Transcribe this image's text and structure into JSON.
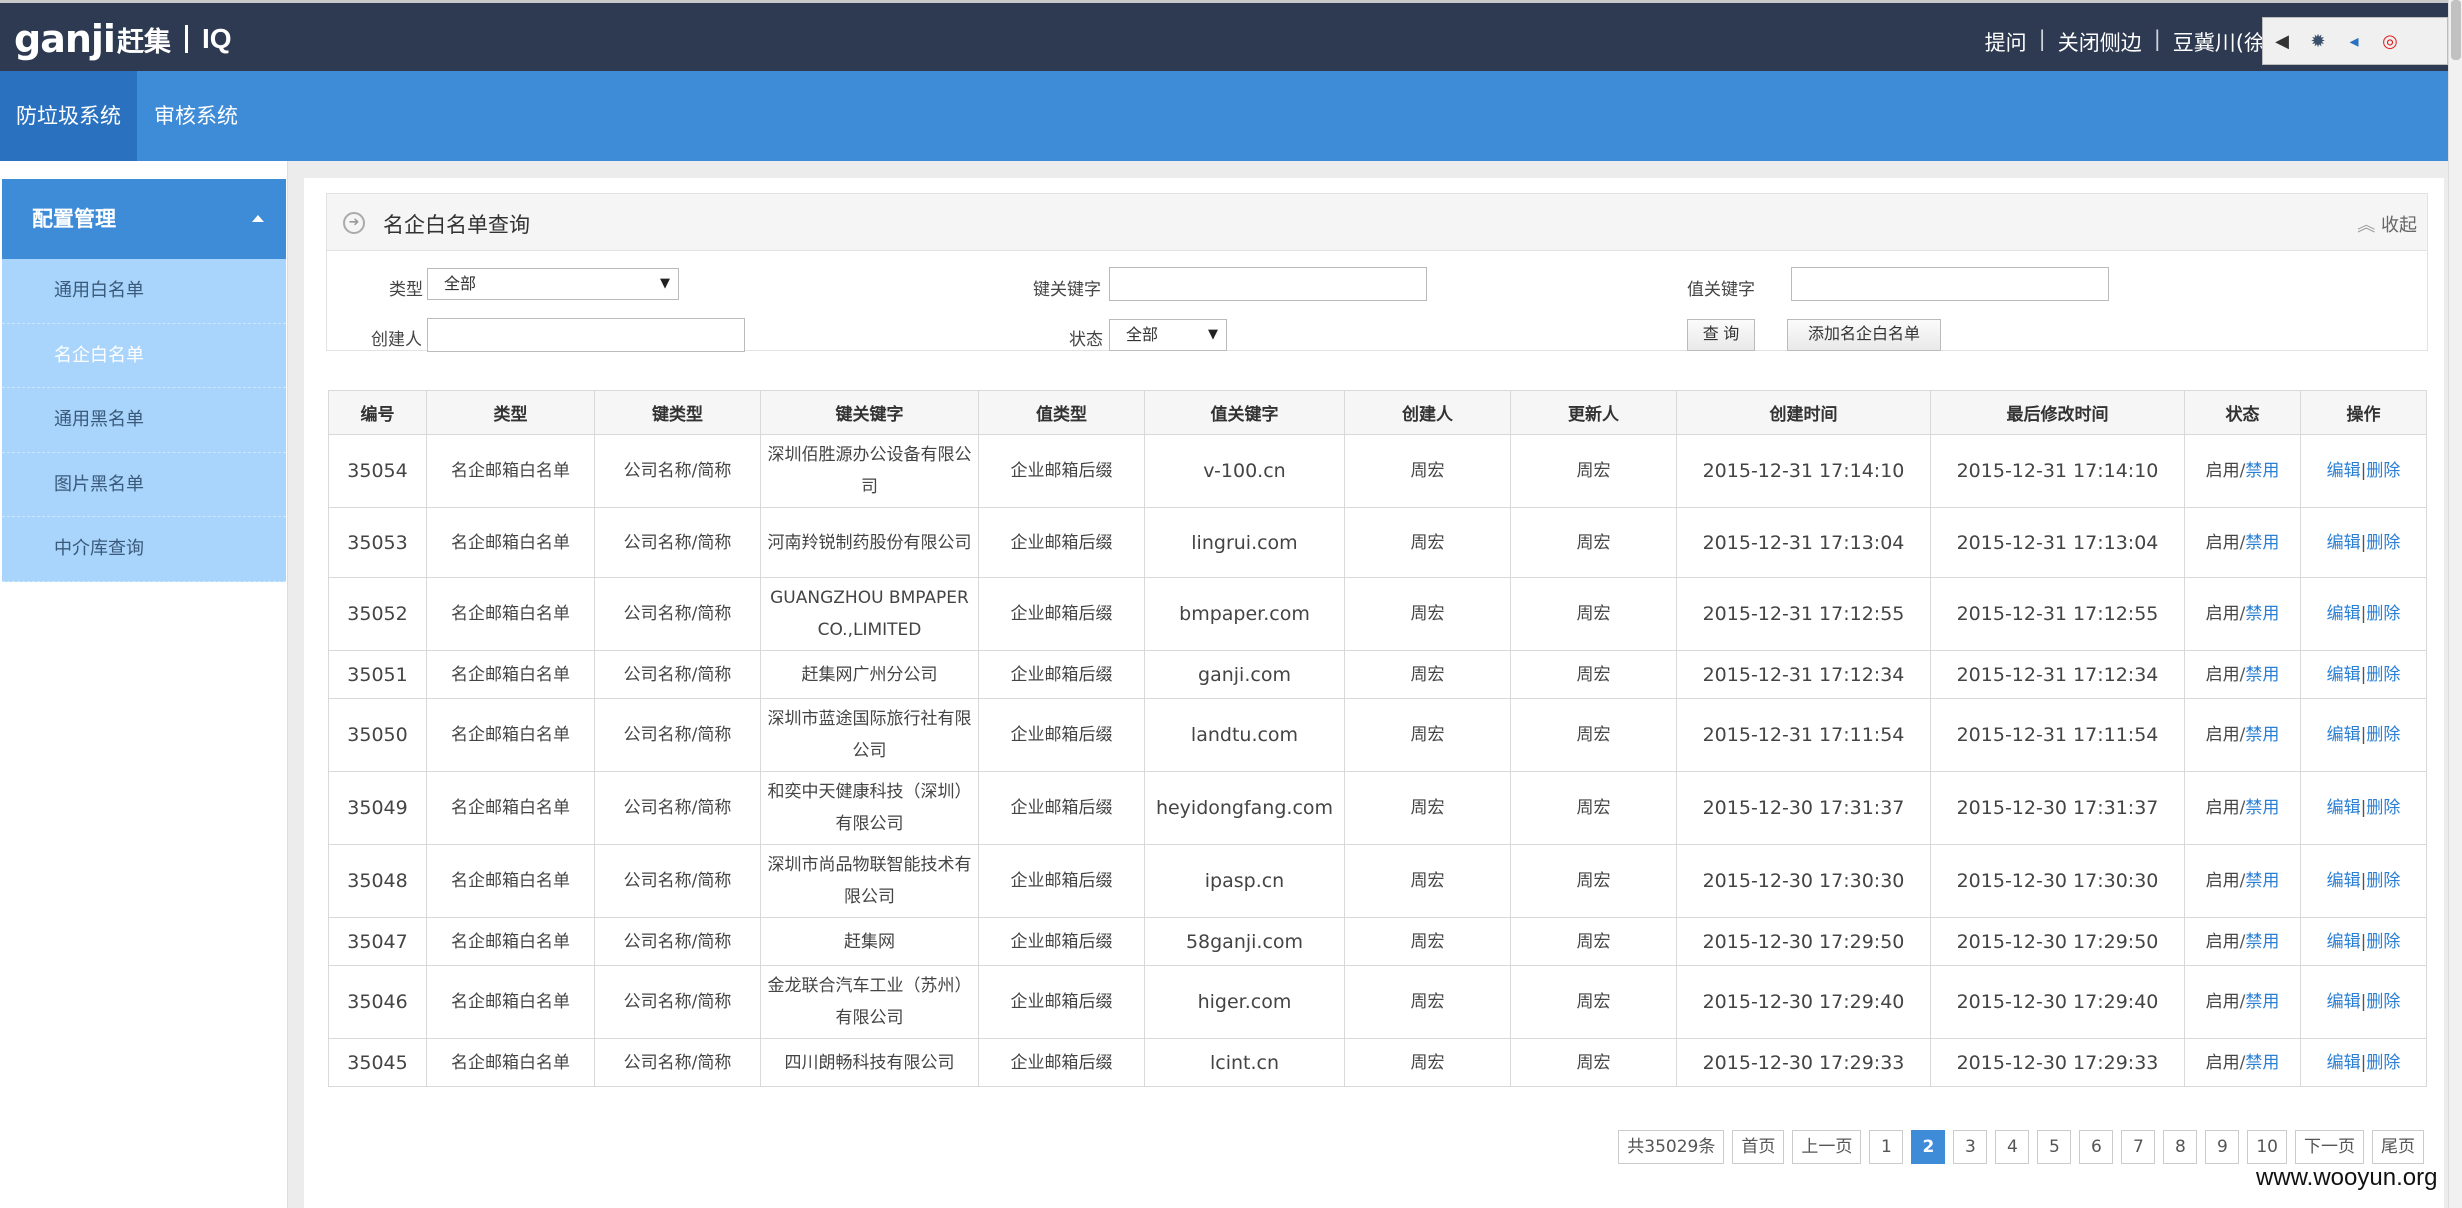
{
  "header": {
    "logo_main": "ganji",
    "logo_cn": "赶集",
    "logo_iq": "IQ",
    "links": [
      "提问",
      "关闭侧边",
      "豆冀川(徐洋"
    ],
    "tray_icons": [
      "arrow-left-icon",
      "gear-icon",
      "triangle-left-icon",
      "lifebuoy-icon"
    ]
  },
  "nav": {
    "items": [
      {
        "label": "防垃圾系统",
        "active": true
      },
      {
        "label": "审核系统",
        "active": false
      }
    ]
  },
  "sidebar": {
    "section": "配置管理",
    "items": [
      {
        "label": "通用白名单",
        "active": false
      },
      {
        "label": "名企白名单",
        "active": true
      },
      {
        "label": "通用黑名单",
        "active": false
      },
      {
        "label": "图片黑名单",
        "active": false
      },
      {
        "label": "中介库查询",
        "active": false
      }
    ]
  },
  "panel": {
    "title": "名企白名单查询",
    "collapse_label": "收起"
  },
  "form": {
    "type_label": "类型",
    "type_value": "全部",
    "key_label": "键关键字",
    "key_value": "",
    "val_label": "值关键字",
    "val_value": "",
    "creator_label": "创建人",
    "creator_value": "",
    "status_label": "状态",
    "status_value": "全部",
    "query_button": "查 询",
    "add_button": "添加名企白名单"
  },
  "table": {
    "columns": [
      "编号",
      "类型",
      "键类型",
      "键关键字",
      "值类型",
      "值关键字",
      "创建人",
      "更新人",
      "创建时间",
      "最后修改时间",
      "状态",
      "操作"
    ],
    "action_enable": "启用",
    "action_disable": "禁用",
    "action_edit": "编辑",
    "action_delete": "删除",
    "action_sep": "/",
    "action_sep2": "|",
    "rows": [
      {
        "id": "35054",
        "type": "名企邮箱白名单",
        "key_type": "公司名称/简称",
        "key": "深圳佰胜源办公设备有限公司",
        "val_type": "企业邮箱后缀",
        "val": "v-100.cn",
        "creator": "周宏",
        "updater": "周宏",
        "created": "2015-12-31 17:14:10",
        "modified": "2015-12-31 17:14:10"
      },
      {
        "id": "35053",
        "type": "名企邮箱白名单",
        "key_type": "公司名称/简称",
        "key": "河南羚锐制药股份有限公司",
        "val_type": "企业邮箱后缀",
        "val": "lingrui.com",
        "creator": "周宏",
        "updater": "周宏",
        "created": "2015-12-31 17:13:04",
        "modified": "2015-12-31 17:13:04"
      },
      {
        "id": "35052",
        "type": "名企邮箱白名单",
        "key_type": "公司名称/简称",
        "key": "GUANGZHOU BMPAPER CO.,LIMITED",
        "val_type": "企业邮箱后缀",
        "val": "bmpaper.com",
        "creator": "周宏",
        "updater": "周宏",
        "created": "2015-12-31 17:12:55",
        "modified": "2015-12-31 17:12:55"
      },
      {
        "id": "35051",
        "type": "名企邮箱白名单",
        "key_type": "公司名称/简称",
        "key": "赶集网广州分公司",
        "val_type": "企业邮箱后缀",
        "val": "ganji.com",
        "creator": "周宏",
        "updater": "周宏",
        "created": "2015-12-31 17:12:34",
        "modified": "2015-12-31 17:12:34"
      },
      {
        "id": "35050",
        "type": "名企邮箱白名单",
        "key_type": "公司名称/简称",
        "key": "深圳市蓝途国际旅行社有限公司",
        "val_type": "企业邮箱后缀",
        "val": "landtu.com",
        "creator": "周宏",
        "updater": "周宏",
        "created": "2015-12-31 17:11:54",
        "modified": "2015-12-31 17:11:54"
      },
      {
        "id": "35049",
        "type": "名企邮箱白名单",
        "key_type": "公司名称/简称",
        "key": "和奕中天健康科技（深圳）有限公司",
        "val_type": "企业邮箱后缀",
        "val": "heyidongfang.com",
        "creator": "周宏",
        "updater": "周宏",
        "created": "2015-12-30 17:31:37",
        "modified": "2015-12-30 17:31:37"
      },
      {
        "id": "35048",
        "type": "名企邮箱白名单",
        "key_type": "公司名称/简称",
        "key": "深圳市尚品物联智能技术有限公司",
        "val_type": "企业邮箱后缀",
        "val": "ipasp.cn",
        "creator": "周宏",
        "updater": "周宏",
        "created": "2015-12-30 17:30:30",
        "modified": "2015-12-30 17:30:30"
      },
      {
        "id": "35047",
        "type": "名企邮箱白名单",
        "key_type": "公司名称/简称",
        "key": "赶集网",
        "val_type": "企业邮箱后缀",
        "val": "58ganji.com",
        "creator": "周宏",
        "updater": "周宏",
        "created": "2015-12-30 17:29:50",
        "modified": "2015-12-30 17:29:50"
      },
      {
        "id": "35046",
        "type": "名企邮箱白名单",
        "key_type": "公司名称/简称",
        "key": "金龙联合汽车工业（苏州）有限公司",
        "val_type": "企业邮箱后缀",
        "val": "higer.com",
        "creator": "周宏",
        "updater": "周宏",
        "created": "2015-12-30 17:29:40",
        "modified": "2015-12-30 17:29:40"
      },
      {
        "id": "35045",
        "type": "名企邮箱白名单",
        "key_type": "公司名称/简称",
        "key": "四川朗畅科技有限公司",
        "val_type": "企业邮箱后缀",
        "val": "lcint.cn",
        "creator": "周宏",
        "updater": "周宏",
        "created": "2015-12-30 17:29:33",
        "modified": "2015-12-30 17:29:33"
      }
    ]
  },
  "pager": {
    "total": "共35029条",
    "first": "首页",
    "prev": "上一页",
    "pages": [
      "1",
      "2",
      "3",
      "4",
      "5",
      "6",
      "7",
      "8",
      "9",
      "10"
    ],
    "current": "2",
    "next": "下一页",
    "last": "尾页"
  },
  "watermark": "www.wooyun.org"
}
